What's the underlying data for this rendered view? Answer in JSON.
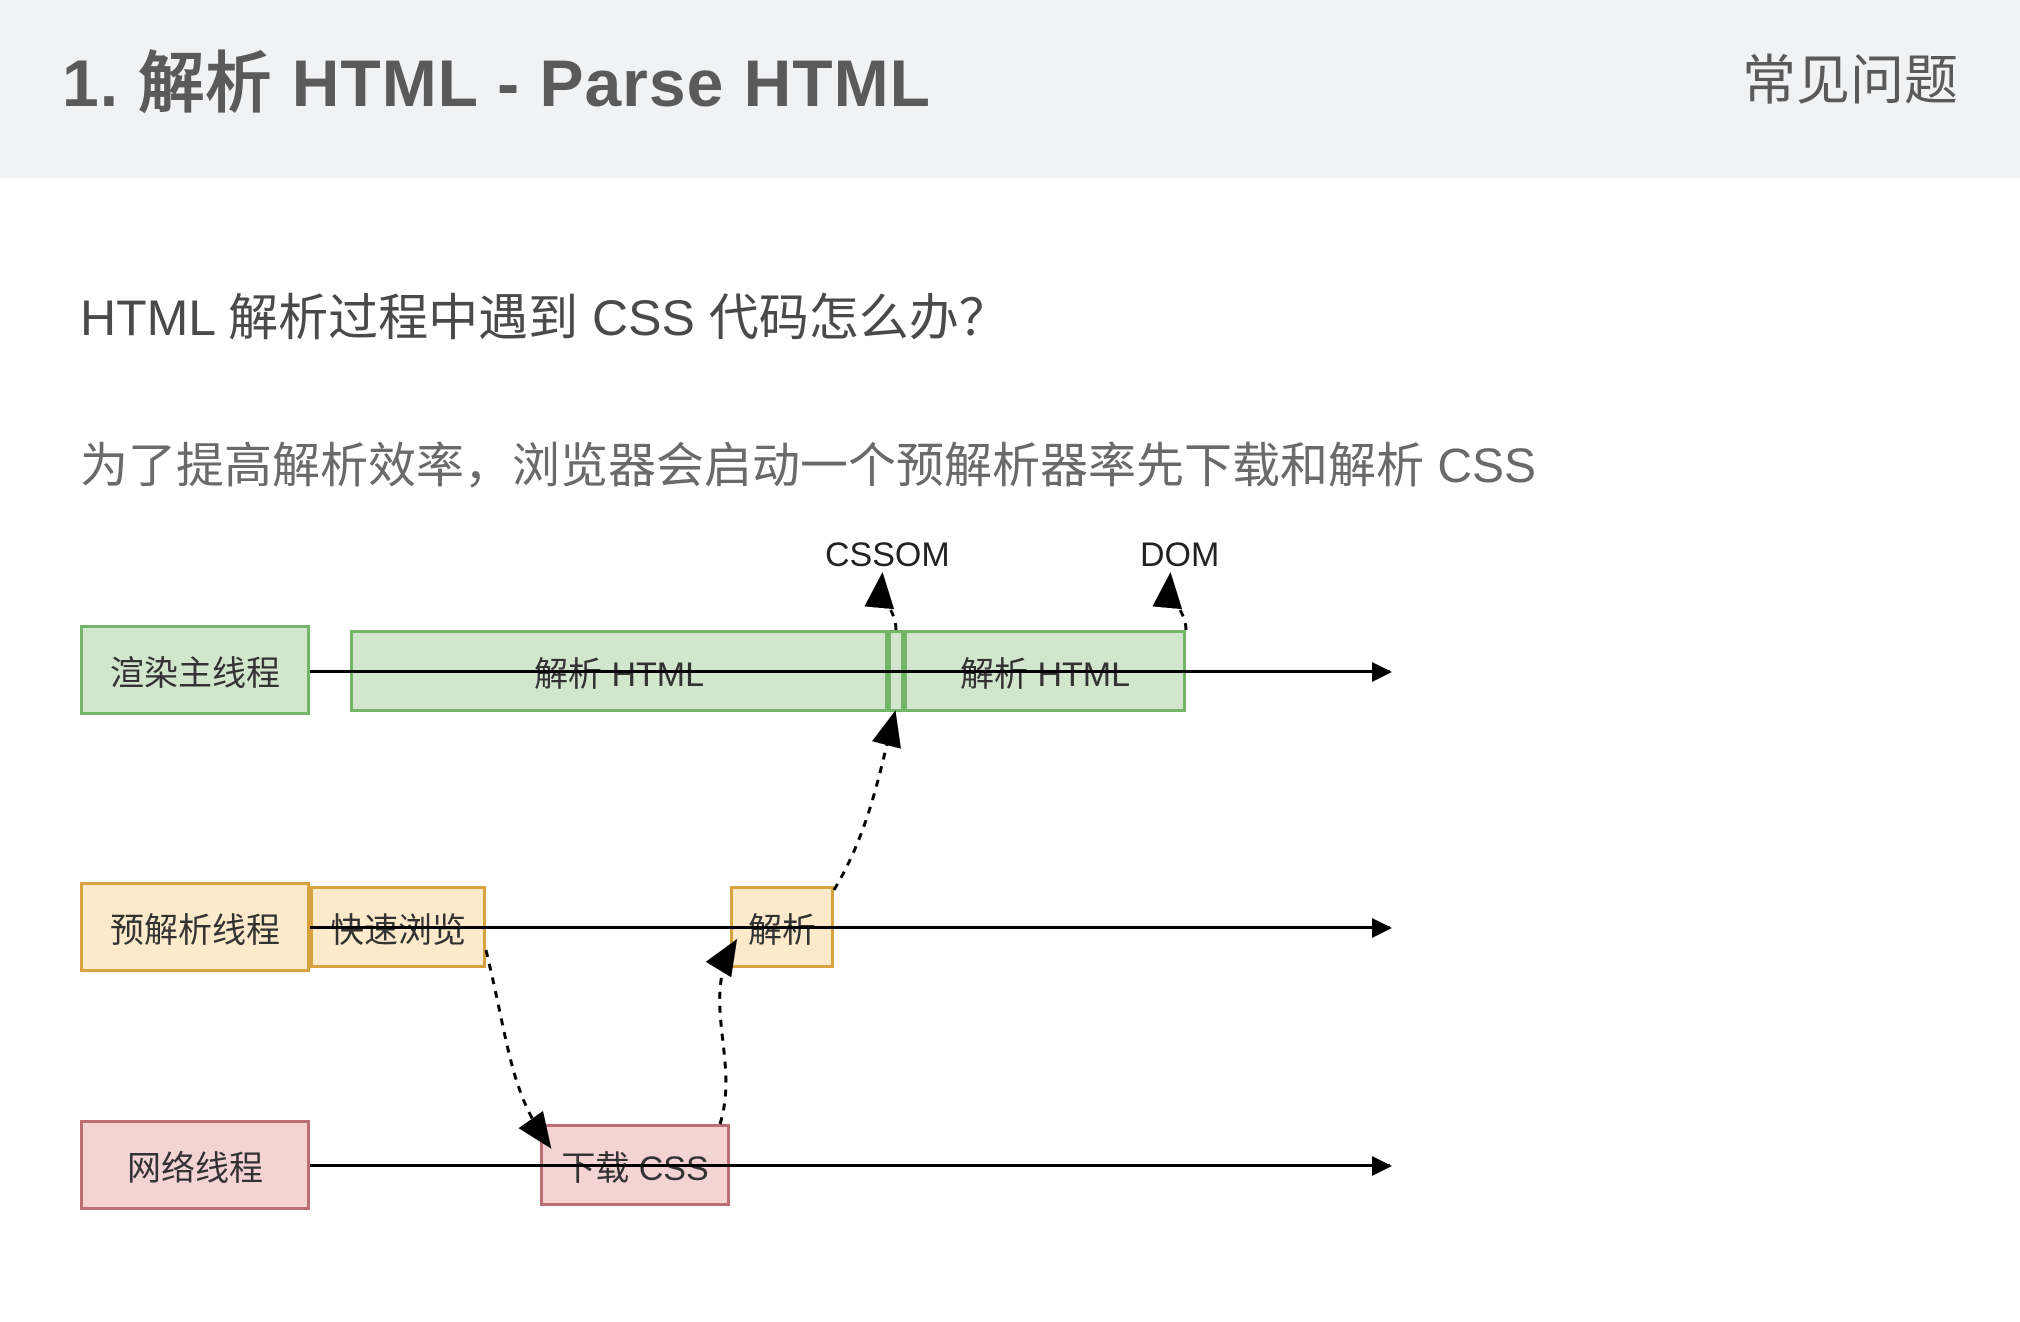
{
  "header": {
    "title": "1. 解析 HTML - Parse HTML",
    "faq": "常见问题"
  },
  "content": {
    "question": "HTML  解析过程中遇到  CSS  代码怎么办？",
    "answer": "为了提高解析效率，浏览器会启动一个预解析器率先下载和解析  CSS"
  },
  "diagram": {
    "outputs": {
      "cssom": "CSSOM",
      "dom": "DOM"
    },
    "lanes": {
      "render": {
        "label": "渲染主线程",
        "boxes": {
          "parse1": "解析 HTML",
          "parse2": "解析 HTML"
        }
      },
      "preparse": {
        "label": "预解析线程",
        "boxes": {
          "scan": "快速浏览",
          "parse": "解析"
        }
      },
      "network": {
        "label": "网络线程",
        "boxes": {
          "download": "下载 CSS"
        }
      }
    },
    "colors": {
      "green": "#d2e6ce",
      "orange": "#fdeacb",
      "red": "#f4d3d3"
    }
  }
}
